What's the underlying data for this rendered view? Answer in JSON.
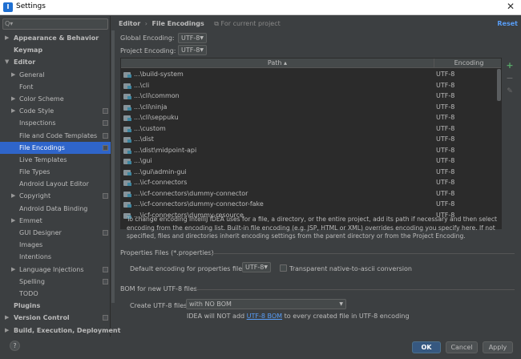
{
  "window": {
    "title": "Settings",
    "close_glyph": "✕",
    "app_icon": "intellij-icon"
  },
  "sidebar": {
    "search_glyph": "Q▾",
    "items": [
      {
        "label": "Appearance & Behavior",
        "level": 0,
        "bold": true,
        "arrow": "▶"
      },
      {
        "label": "Keymap",
        "level": 0,
        "bold": true,
        "arrow": ""
      },
      {
        "label": "Editor",
        "level": 0,
        "bold": true,
        "arrow": "▼"
      },
      {
        "label": "General",
        "level": 1,
        "bold": false,
        "arrow": "▶",
        "cfg": false
      },
      {
        "label": "Font",
        "level": 1,
        "bold": false,
        "arrow": "",
        "cfg": false
      },
      {
        "label": "Color Scheme",
        "level": 1,
        "bold": false,
        "arrow": "▶",
        "cfg": false
      },
      {
        "label": "Code Style",
        "level": 1,
        "bold": false,
        "arrow": "▶",
        "cfg": true
      },
      {
        "label": "Inspections",
        "level": 1,
        "bold": false,
        "arrow": "",
        "cfg": true
      },
      {
        "label": "File and Code Templates",
        "level": 1,
        "bold": false,
        "arrow": "",
        "cfg": true
      },
      {
        "label": "File Encodings",
        "level": 1,
        "bold": false,
        "arrow": "",
        "cfg": true,
        "selected": true
      },
      {
        "label": "Live Templates",
        "level": 1,
        "bold": false,
        "arrow": "",
        "cfg": false
      },
      {
        "label": "File Types",
        "level": 1,
        "bold": false,
        "arrow": "",
        "cfg": false
      },
      {
        "label": "Android Layout Editor",
        "level": 1,
        "bold": false,
        "arrow": "",
        "cfg": false
      },
      {
        "label": "Copyright",
        "level": 1,
        "bold": false,
        "arrow": "▶",
        "cfg": true
      },
      {
        "label": "Android Data Binding",
        "level": 1,
        "bold": false,
        "arrow": "",
        "cfg": false
      },
      {
        "label": "Emmet",
        "level": 1,
        "bold": false,
        "arrow": "▶",
        "cfg": false
      },
      {
        "label": "GUI Designer",
        "level": 1,
        "bold": false,
        "arrow": "",
        "cfg": true
      },
      {
        "label": "Images",
        "level": 1,
        "bold": false,
        "arrow": "",
        "cfg": false
      },
      {
        "label": "Intentions",
        "level": 1,
        "bold": false,
        "arrow": "",
        "cfg": false
      },
      {
        "label": "Language Injections",
        "level": 1,
        "bold": false,
        "arrow": "▶",
        "cfg": true
      },
      {
        "label": "Spelling",
        "level": 1,
        "bold": false,
        "arrow": "",
        "cfg": true
      },
      {
        "label": "TODO",
        "level": 1,
        "bold": false,
        "arrow": "",
        "cfg": false
      },
      {
        "label": "Plugins",
        "level": 0,
        "bold": true,
        "arrow": ""
      },
      {
        "label": "Version Control",
        "level": 0,
        "bold": true,
        "arrow": "▶",
        "cfg": true
      },
      {
        "label": "Build, Execution, Deployment",
        "level": 0,
        "bold": true,
        "arrow": "▶"
      }
    ]
  },
  "breadcrumb": {
    "first": "Editor",
    "separator": "›",
    "second": "File Encodings",
    "scope": "For current project"
  },
  "reset_label": "Reset",
  "global_encoding": {
    "label": "Global Encoding:",
    "value": "UTF-8"
  },
  "project_encoding": {
    "label": "Project Encoding:",
    "value": "UTF-8"
  },
  "table": {
    "col_path": "Path ▴",
    "col_encoding": "Encoding",
    "rows": [
      {
        "path": "...\\build-system",
        "encoding": "UTF-8"
      },
      {
        "path": "...\\cli",
        "encoding": "UTF-8"
      },
      {
        "path": "...\\cli\\common",
        "encoding": "UTF-8"
      },
      {
        "path": "...\\cli\\ninja",
        "encoding": "UTF-8"
      },
      {
        "path": "...\\cli\\seppuku",
        "encoding": "UTF-8"
      },
      {
        "path": "...\\custom",
        "encoding": "UTF-8"
      },
      {
        "path": "...\\dist",
        "encoding": "UTF-8"
      },
      {
        "path": "...\\dist\\midpoint-api",
        "encoding": "UTF-8"
      },
      {
        "path": "...\\gui",
        "encoding": "UTF-8"
      },
      {
        "path": "...\\gui\\admin-gui",
        "encoding": "UTF-8"
      },
      {
        "path": "...\\icf-connectors",
        "encoding": "UTF-8"
      },
      {
        "path": "...\\icf-connectors\\dummy-connector",
        "encoding": "UTF-8"
      },
      {
        "path": "...\\icf-connectors\\dummy-connector-fake",
        "encoding": "UTF-8"
      },
      {
        "path": "...\\icf-connectors\\dummy-resource",
        "encoding": "UTF-8"
      }
    ],
    "add_glyph": "+",
    "remove_glyph": "−",
    "edit_glyph": "✎"
  },
  "help_text": "To change encoding IntelliJ IDEA uses for a file, a directory, or the entire project, add its path if necessary and then select encoding from the encoding list. Built-in file encoding (e.g. JSP, HTML or XML) overrides encoding you specify here. If not specified, files and directories inherit encoding settings from the parent directory or from the Project Encoding.",
  "properties": {
    "section": "Properties Files (*.properties)",
    "default_label": "Default encoding for properties files:",
    "default_value": "UTF-8",
    "native_label": "Transparent native-to-ascii conversion"
  },
  "bom": {
    "section": "BOM for new UTF-8 files",
    "create_label": "Create UTF-8 files:",
    "create_value": "with NO BOM",
    "note_prefix": "IDEA will NOT add ",
    "note_link": "UTF-8 BOM",
    "note_suffix": " to every created file in UTF-8 encoding"
  },
  "footer": {
    "help": "?",
    "ok": "OK",
    "cancel": "Cancel",
    "apply": "Apply"
  },
  "colors": {
    "background": "#3c3f41",
    "accent_link": "#589df6",
    "selected": "#2f65ca",
    "primary_button": "#365880",
    "add_green": "#59a869"
  }
}
